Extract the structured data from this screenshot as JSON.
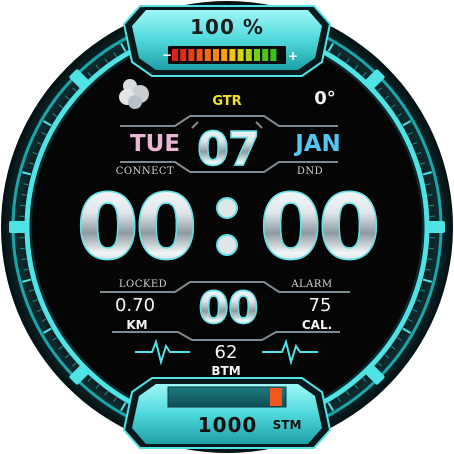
{
  "battery": {
    "percent_label": "100 %",
    "level": 1.0,
    "minus_glyph": "−",
    "plus_glyph": "+"
  },
  "weather": {
    "icon": "cloud-sun-icon",
    "temperature": "0°"
  },
  "brand": "GTR",
  "date": {
    "weekday": "TUE",
    "day": "07",
    "month": "JAN"
  },
  "status_labels": {
    "connect": "CONNECT",
    "dnd": "DND",
    "locked": "LOCKED",
    "alarm": "ALARM"
  },
  "time": {
    "hours": "00",
    "minutes": "00",
    "seconds": "00",
    "separator_icon": "colon-dots-icon"
  },
  "distance": {
    "value": "0.70",
    "unit": "KM"
  },
  "calories": {
    "value": "75",
    "unit": "CAL."
  },
  "heart_rate": {
    "value": "62",
    "unit": "BTM",
    "icon": "heartbeat-wave-icon"
  },
  "steps": {
    "value": "1000",
    "unit": "STM",
    "progress": 0.1
  },
  "colors": {
    "accent": "#4fe3e6",
    "background": "#050505",
    "weekday": "#e9b6d4",
    "month": "#52c7f5",
    "brand": "#f4e030"
  }
}
